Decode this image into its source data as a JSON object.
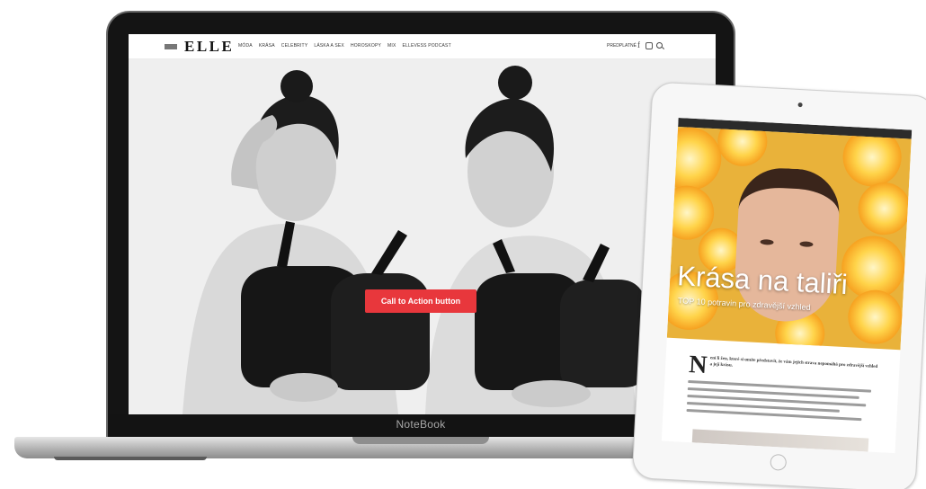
{
  "laptop": {
    "brand": "NoteBook"
  },
  "site": {
    "logo": "ELLE",
    "nav_items": [
      "MÓDA",
      "KRÁSA",
      "CELEBRITY",
      "LÁSKA A SEX",
      "HOROSKOPY",
      "MIX",
      "ELLEVESS PODCAST"
    ],
    "subscribe": "PREDPLATNÉ",
    "cta_label": "Call to Action button"
  },
  "tablet": {
    "nav_items": [
      "",
      "",
      "",
      "",
      "",
      ""
    ],
    "hero_title": "Krása na taliři",
    "hero_subtitle": "TOP 10 potravin pro zdravější vzhled",
    "dropcap": "N",
    "lead_text": "ení li žen, které si umíte představit, že vám jejich strava nepomáhá pro zdravější vzhled a její krásu."
  },
  "colors": {
    "accent": "#e8373c",
    "bezel": "#141414",
    "base": "#b2b2b2"
  }
}
